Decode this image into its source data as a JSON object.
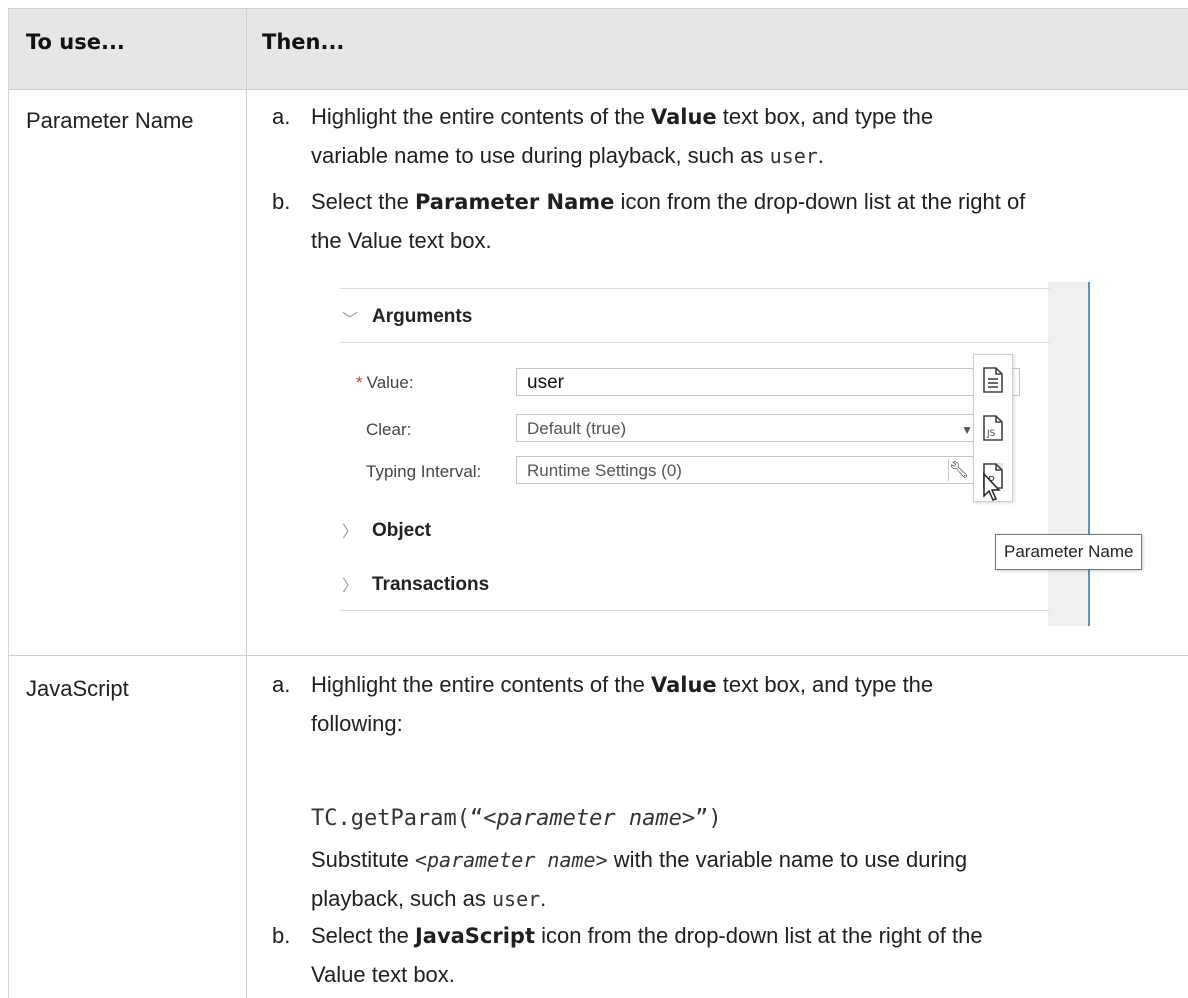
{
  "table": {
    "header": {
      "col1": "To use...",
      "col2": "Then..."
    },
    "rows": [
      {
        "label": "Parameter Name",
        "steps": [
          {
            "letter": "a.",
            "t1": "Highlight the entire contents of the ",
            "b1": "Value",
            "t2": " text box, and type the",
            "t3": "variable name to use during playback, such as ",
            "code": "user",
            "t4": "."
          },
          {
            "letter": "b.",
            "t1": "Select the ",
            "b1": "Parameter Name",
            "t2": " icon from the drop-down list at the right of",
            "t3": "the Value text box."
          }
        ]
      },
      {
        "label": "JavaScript",
        "steps": [
          {
            "letter": "a.",
            "t1": "Highlight the entire contents of the ",
            "b1": "Value",
            "t2": " text box, and type the",
            "t3": "following:",
            "code_line_prefix": "TC.getParam(“",
            "code_line_param": "<parameter name>",
            "code_line_suffix": "”)",
            "sub1": "Substitute ",
            "sub_param": "<parameter name>",
            "sub2": " with the variable name to use during",
            "sub3": "playback, such as ",
            "sub_code": "user",
            "sub4": "."
          },
          {
            "letter": "b.",
            "t1": "Select the ",
            "b1": "JavaScript",
            "t2": " icon from the drop-down list at the right of the",
            "t3": "Value text box."
          }
        ]
      }
    ]
  },
  "screenshot": {
    "sections": {
      "arguments": "Arguments",
      "object": "Object",
      "transactions": "Transactions"
    },
    "fields": {
      "value_label": "Value:",
      "value": "user",
      "clear_label": "Clear:",
      "clear_value": "Default (true)",
      "typing_label": "Typing Interval:",
      "typing_value": "Runtime Settings (0)"
    },
    "required_mark": "*",
    "tooltip": "Parameter Name",
    "icons": [
      "text-value-icon",
      "javascript-icon",
      "parameter-name-icon"
    ]
  }
}
